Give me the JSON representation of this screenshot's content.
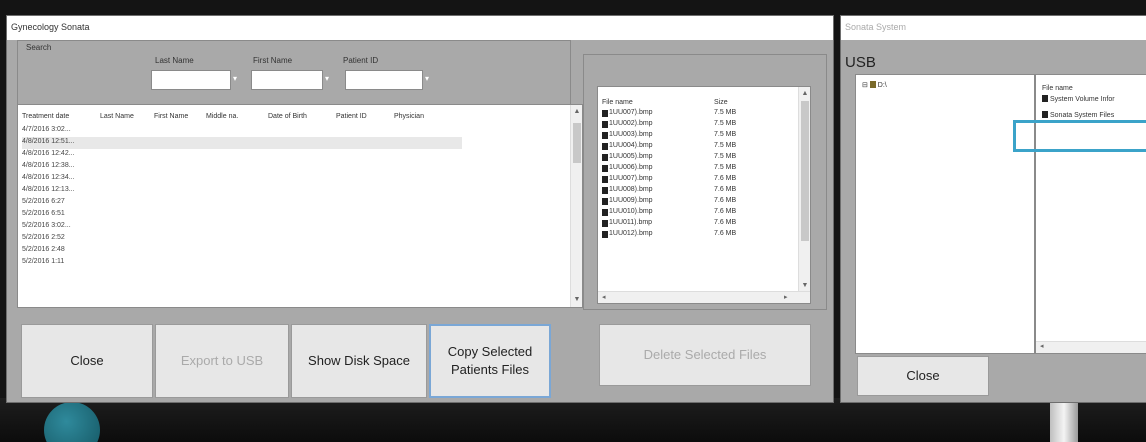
{
  "main_window": {
    "title": "Gynecology Sonata",
    "search": {
      "legend": "Search",
      "last_name_label": "Last Name",
      "first_name_label": "First Name",
      "patient_id_label": "Patient ID",
      "last_name_value": "",
      "first_name_value": "",
      "patient_id_value": ""
    },
    "patients": {
      "columns": [
        "Treatment date",
        "Last Name",
        "First Name",
        "Middle na.",
        "Date of Birth",
        "Patient ID",
        "Physician"
      ],
      "rows": [
        "4/7/2016 3:02...",
        "4/8/2016 12:51...",
        "4/8/2016 12:42...",
        "4/8/2016 12:38...",
        "4/8/2016 12:34...",
        "4/8/2016 12:13...",
        "5/2/2016 6:27",
        "5/2/2016 6:51",
        "5/2/2016 3:02...",
        "5/2/2016 2:52",
        "5/2/2016 2:48",
        "5/2/2016 1:11"
      ],
      "selected_index": 1
    },
    "files": {
      "columns": [
        "File name",
        "Size"
      ],
      "rows": [
        {
          "name": "1UU007).bmp",
          "size": "7.5 MB"
        },
        {
          "name": "1UU002).bmp",
          "size": "7.5 MB"
        },
        {
          "name": "1UU003).bmp",
          "size": "7.5 MB"
        },
        {
          "name": "1UU004).bmp",
          "size": "7.5 MB"
        },
        {
          "name": "1UU005).bmp",
          "size": "7.5 MB"
        },
        {
          "name": "1UU006).bmp",
          "size": "7.5 MB"
        },
        {
          "name": "1UU007).bmp",
          "size": "7.6 MB"
        },
        {
          "name": "1UU008).bmp",
          "size": "7.6 MB"
        },
        {
          "name": "1UU009).bmp",
          "size": "7.6 MB"
        },
        {
          "name": "1UU010).bmp",
          "size": "7.6 MB"
        },
        {
          "name": "1UU011).bmp",
          "size": "7.6 MB"
        },
        {
          "name": "1UU012).bmp",
          "size": "7.6 MB"
        }
      ]
    },
    "buttons": {
      "close": "Close",
      "export": "Export to USB",
      "disk_space": "Show Disk Space",
      "copy": "Copy Selected Patients Files",
      "delete": "Delete Selected Files"
    }
  },
  "system_window": {
    "title": "Sonata System",
    "usb_label": "USB",
    "tree_node": "D:\\",
    "list_header": "File name",
    "list_rows": [
      "System Volume Infor",
      "Sonata System Files"
    ],
    "close_button": "Close"
  },
  "colors": {
    "window_bg": "#a9a9a9",
    "highlight": "#3ba3c9",
    "focus_border": "#7aa7d6"
  }
}
